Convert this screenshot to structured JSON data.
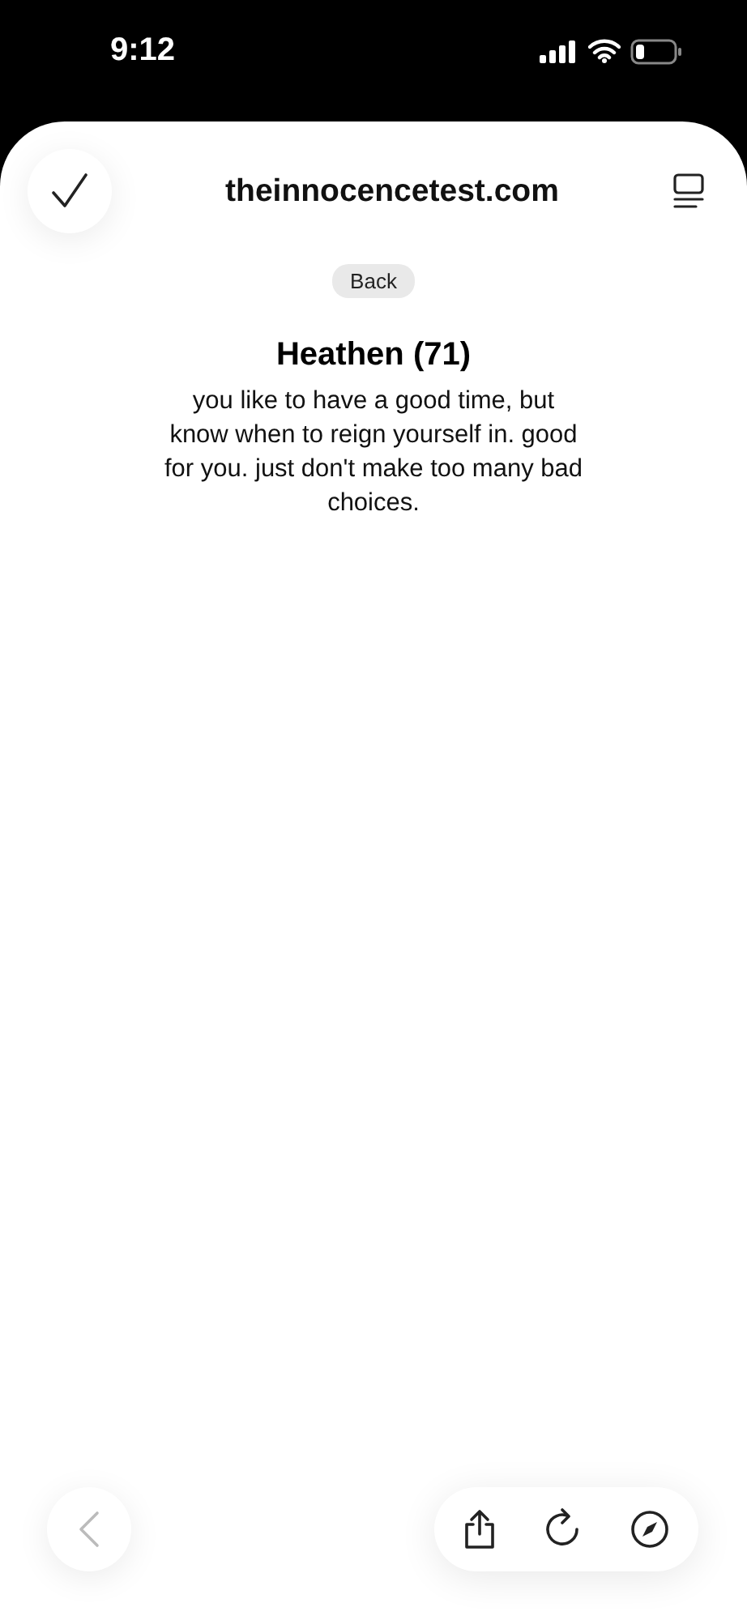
{
  "status_bar": {
    "time": "9:12"
  },
  "browser": {
    "domain": "theinnocencetest.com"
  },
  "page": {
    "back_button": "Back",
    "title": "Heathen (71)",
    "description": "you like to have a good time, but know when to reign yourself in. good for you. just don't make too many bad choices."
  },
  "toolbar": {
    "back_disabled": true
  }
}
